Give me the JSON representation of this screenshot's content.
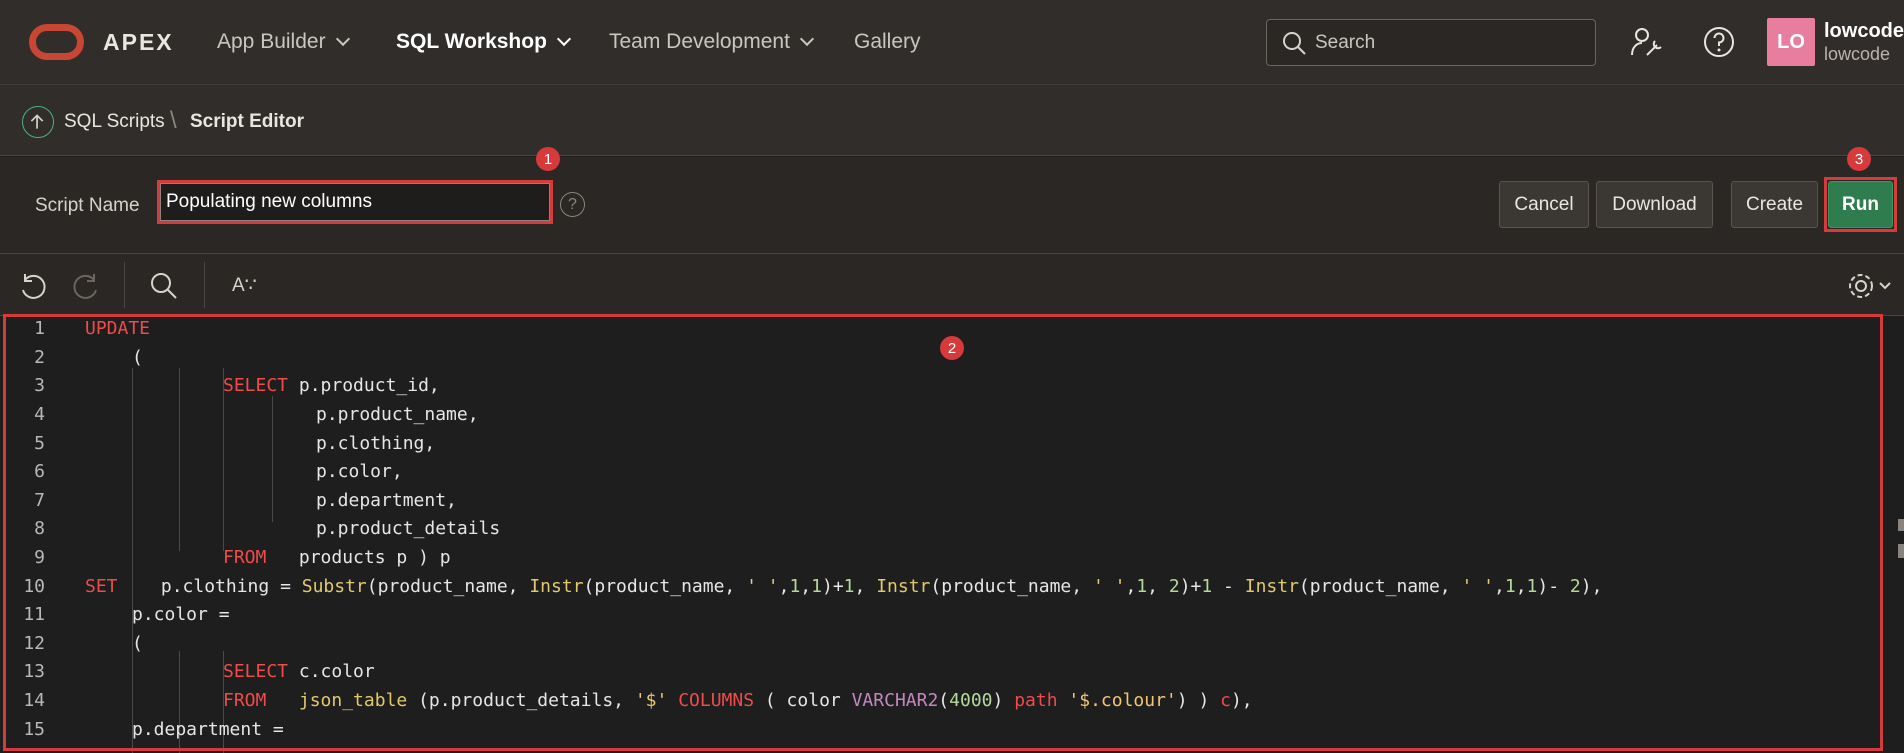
{
  "brand": "APEX",
  "nav": {
    "items": [
      {
        "label": "App Builder",
        "dropdown": true
      },
      {
        "label": "SQL Workshop",
        "dropdown": true,
        "active": true
      },
      {
        "label": "Team Development",
        "dropdown": true
      },
      {
        "label": "Gallery",
        "dropdown": false
      }
    ],
    "search_placeholder": "Search"
  },
  "user": {
    "initials": "LO",
    "name": "lowcode",
    "workspace": "lowcode",
    "avatar_color": "#e77ea0"
  },
  "breadcrumb": {
    "parent": "SQL Scripts",
    "current": "Script Editor"
  },
  "script": {
    "name_label": "Script Name",
    "name_value": "Populating new columns",
    "buttons": {
      "cancel": "Cancel",
      "download": "Download",
      "create": "Create",
      "run": "Run"
    }
  },
  "markers": [
    "1",
    "2",
    "3"
  ],
  "toolbar": {
    "font_size_label": "A∵"
  },
  "editor": {
    "lines": [
      {
        "n": "1"
      },
      {
        "n": "2"
      },
      {
        "n": "3"
      },
      {
        "n": "4"
      },
      {
        "n": "5"
      },
      {
        "n": "6"
      },
      {
        "n": "7"
      },
      {
        "n": "8"
      },
      {
        "n": "9"
      },
      {
        "n": "10"
      },
      {
        "n": "11"
      },
      {
        "n": "12"
      },
      {
        "n": "13"
      },
      {
        "n": "14"
      },
      {
        "n": "15"
      }
    ],
    "tokens": {
      "l1": "UPDATE",
      "l2": "(",
      "l3_kw": "SELECT",
      "l3": " p.product_id,",
      "l4": "p.product_name,",
      "l5": "p.clothing,",
      "l6": "p.color,",
      "l7": "p.department,",
      "l8": "p.product_details",
      "l9_kw": "FROM",
      "l9": "   products p ) p",
      "l10_kw": "SET",
      "l10_a": "    p.clothing = ",
      "l10_f1": "Substr",
      "l10_b": "(product_name, ",
      "l10_f2": "Instr",
      "l10_c": "(product_name, ",
      "l10_s1": "' '",
      "l10_d": ",",
      "l10_n1": "1",
      "l10_e": ",",
      "l10_n2": "1",
      "l10_g": ")+",
      "l10_n3": "1",
      "l10_h": ", ",
      "l10_f3": "Instr",
      "l10_i": "(product_name, ",
      "l10_s2": "' '",
      "l10_j": ",",
      "l10_n4": "1",
      "l10_k": ", ",
      "l10_n5": "2",
      "l10_l": ")+",
      "l10_n6": "1",
      "l10_m": " - ",
      "l10_f4": "Instr",
      "l10_o": "(product_name, ",
      "l10_s3": "' '",
      "l10_p": ",",
      "l10_n7": "1",
      "l10_q": ",",
      "l10_n8": "1",
      "l10_r": ")- ",
      "l10_n9": "2",
      "l10_t": "),",
      "l11": "p.color =",
      "l12": "(",
      "l13_kw": "SELECT",
      "l13": " c.color",
      "l14_kw": "FROM",
      "l14_a": "   ",
      "l14_f": "json_table",
      "l14_b": " (p.product_details, ",
      "l14_s1": "'$'",
      "l14_c": " ",
      "l14_kw2": "COLUMNS",
      "l14_d": " ( color ",
      "l14_t": "VARCHAR2",
      "l14_e": "(",
      "l14_n": "4000",
      "l14_g": ") ",
      "l14_kw3": "path",
      "l14_h": " ",
      "l14_s2": "'$.colour'",
      "l14_i": ") ) ",
      "l14_kw4": "c",
      "l14_j": "),",
      "l15": "p.department ="
    }
  },
  "colors": {
    "accent_red": "#d63a3a",
    "run_green": "#2f7d4f",
    "keyword": "#ef4b4b",
    "function": "#e2c96c",
    "number": "#b5d99c",
    "type": "#c586c0"
  }
}
